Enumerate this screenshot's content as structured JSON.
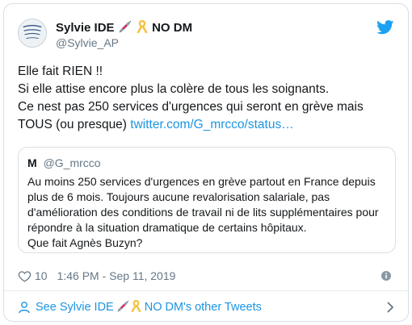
{
  "author": {
    "name": "Sylvie IDE",
    "name_suffix": "NO DM",
    "handle": "@Sylvie_AP",
    "emojis": [
      "syringe-icon",
      "ribbon-icon"
    ]
  },
  "tweet": {
    "lines": [
      "Elle fait RIEN !!",
      "Si elle attise encore plus la colère de tous les soignants.",
      "Ce nest pas 250 services d'urgences qui seront en grève mais"
    ],
    "last_line_text": "TOUS (ou presque) ",
    "link": "twitter.com/G_mrcco/status…"
  },
  "quoted": {
    "name": "M",
    "handle": "@G_mrcco",
    "lines": [
      "Au moins 250 services d'urgences en grève partout en France depuis",
      "plus de 6 mois. Toujours aucune revalorisation salariale, pas",
      "d'amélioration des conditions de travail ni de lits supplémentaires pour",
      "répondre à la situation dramatique de certains hôpitaux.",
      "Que fait Agnès Buzyn?"
    ]
  },
  "meta": {
    "likes": "10",
    "timestamp": "1:46 PM - Sep 11, 2019"
  },
  "footer": {
    "prefix": "See Sylvie IDE",
    "suffix": "NO DM's other Tweets"
  },
  "colors": {
    "link": "#1b95e0",
    "muted": "#657786",
    "border": "#d7dfe5"
  }
}
